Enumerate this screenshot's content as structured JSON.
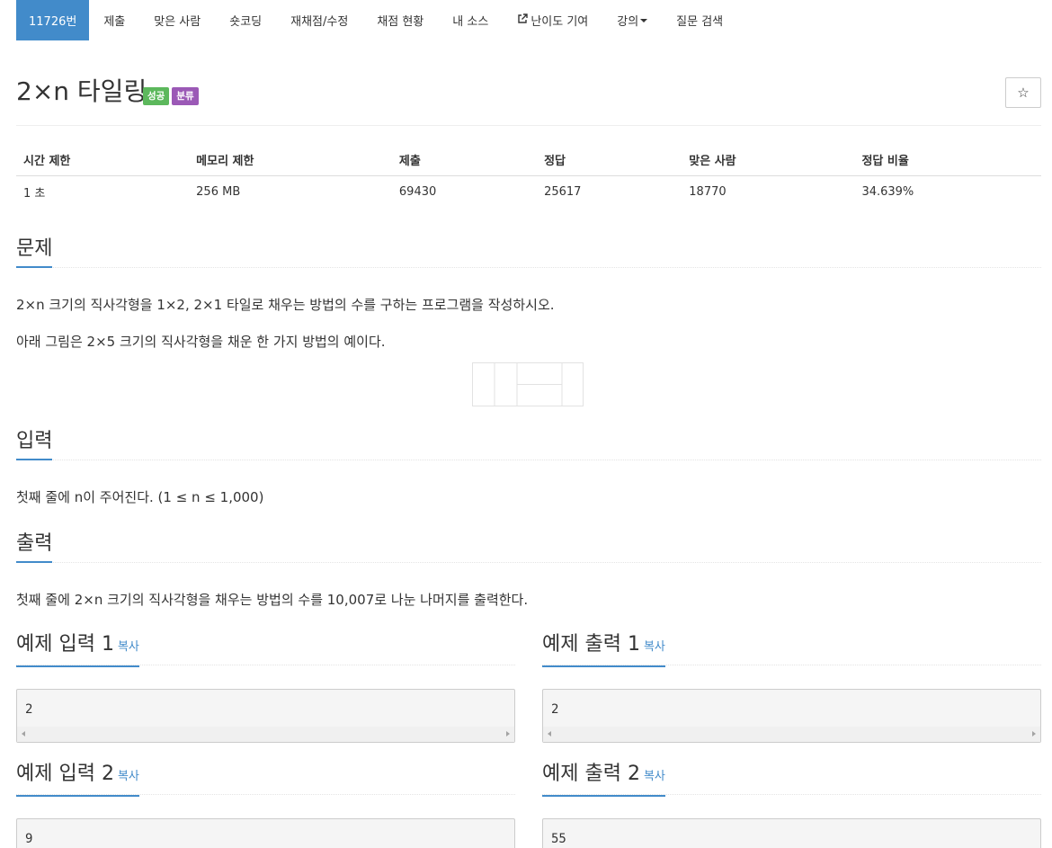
{
  "tabs": [
    {
      "label": "11726번"
    },
    {
      "label": "제출"
    },
    {
      "label": "맞은 사람"
    },
    {
      "label": "숏코딩"
    },
    {
      "label": "재채점/수정"
    },
    {
      "label": "채점 현황"
    },
    {
      "label": "내 소스"
    },
    {
      "label": "난이도 기여",
      "icon": "external-link-icon"
    },
    {
      "label": "강의",
      "icon": "caret-down-icon"
    },
    {
      "label": "질문 검색"
    }
  ],
  "problem": {
    "title": "2×n 타일링",
    "labels": {
      "success": "성공",
      "category": "분류"
    },
    "star_icon": "☆"
  },
  "info": {
    "headers": [
      "시간 제한",
      "메모리 제한",
      "제출",
      "정답",
      "맞은 사람",
      "정답 비율"
    ],
    "values": [
      "1 초",
      "256 MB",
      "69430",
      "25617",
      "18770",
      "34.639%"
    ]
  },
  "sections": {
    "problem": {
      "heading": "문제",
      "line1": "2×n 크기의 직사각형을 1×2, 2×1 타일로 채우는 방법의 수를 구하는 프로그램을 작성하시오.",
      "line2": "아래 그림은 2×5 크기의 직사각형을 채운 한 가지 방법의 예이다."
    },
    "input": {
      "heading": "입력",
      "text": "첫째 줄에 n이 주어진다. (1 ≤ n ≤ 1,000)"
    },
    "output": {
      "heading": "출력",
      "text": "첫째 줄에 2×n 크기의 직사각형을 채우는 방법의 수를 10,007로 나눈 나머지를 출력한다."
    }
  },
  "samples": [
    {
      "input_title": "예제 입력 1",
      "output_title": "예제 출력 1",
      "copy": "복사",
      "input": "2",
      "output": "2"
    },
    {
      "input_title": "예제 입력 2",
      "output_title": "예제 출력 2",
      "copy": "복사",
      "input": "9",
      "output": "55"
    }
  ],
  "colors": {
    "primary": "#428bca",
    "success": "#5cb85c",
    "category": "#9b59b6"
  }
}
